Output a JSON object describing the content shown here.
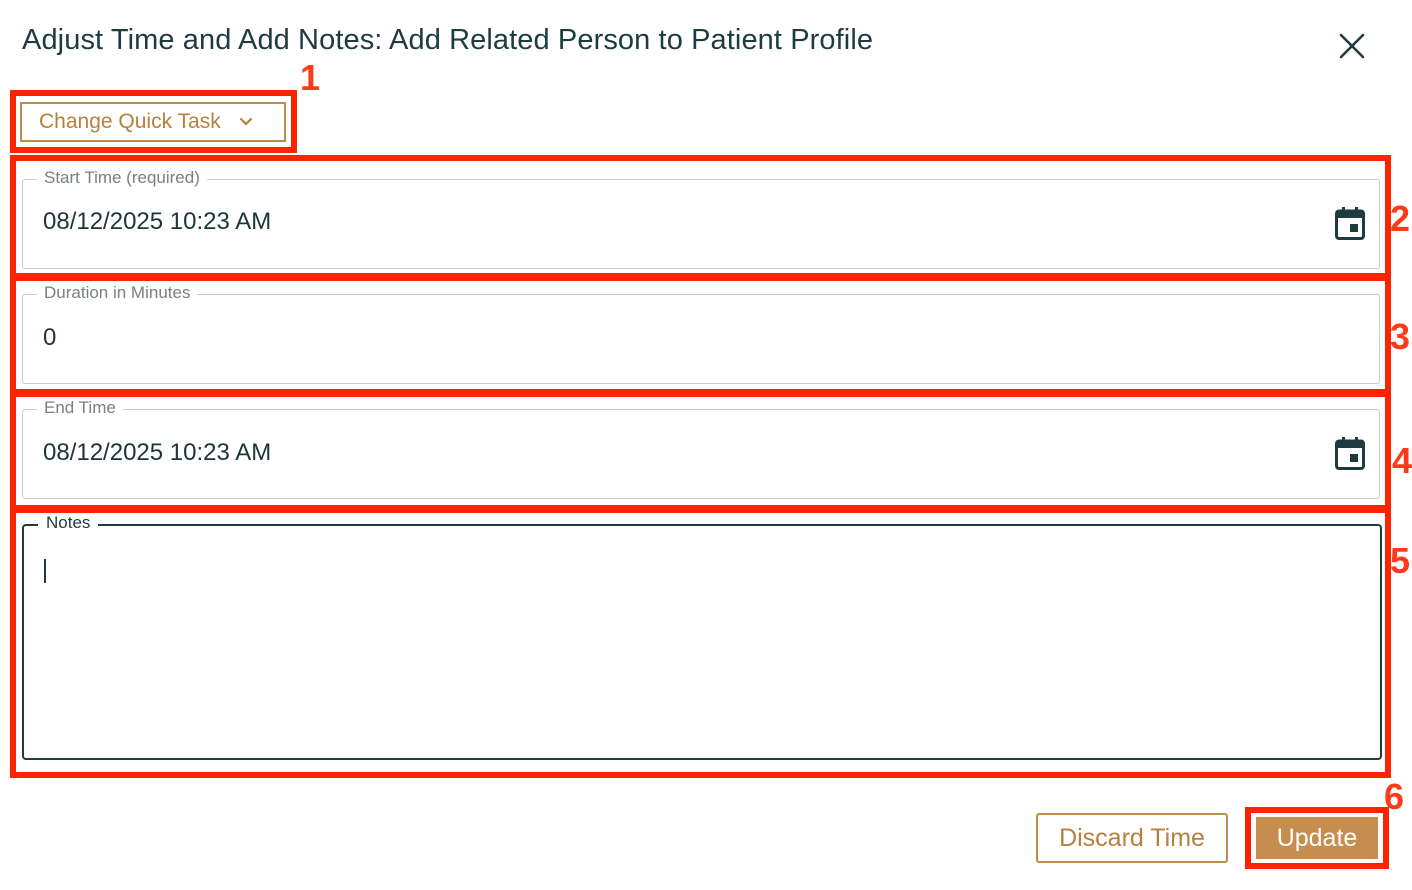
{
  "dialog": {
    "title": "Adjust Time and Add Notes: Add Related Person to Patient Profile"
  },
  "quick_task": {
    "label": "Change Quick Task"
  },
  "fields": {
    "start_time": {
      "label": "Start Time (required)",
      "value": "08/12/2025 10:23 AM"
    },
    "duration": {
      "label": "Duration in Minutes",
      "value": "0"
    },
    "end_time": {
      "label": "End Time",
      "value": "08/12/2025 10:23 AM"
    },
    "notes": {
      "label": "Notes",
      "value": ""
    }
  },
  "actions": {
    "discard_label": "Discard Time",
    "update_label": "Update"
  },
  "callouts": [
    "1",
    "2",
    "3",
    "4",
    "5",
    "6"
  ],
  "colors": {
    "accent": "#c08a4a",
    "primary_button": "#c68d4f",
    "text_dark": "#1e3b3f",
    "callout_red": "#ff2200"
  },
  "icons": {
    "close": "close-icon",
    "dropdown": "chevron-down-icon",
    "calendar": "calendar-icon"
  }
}
